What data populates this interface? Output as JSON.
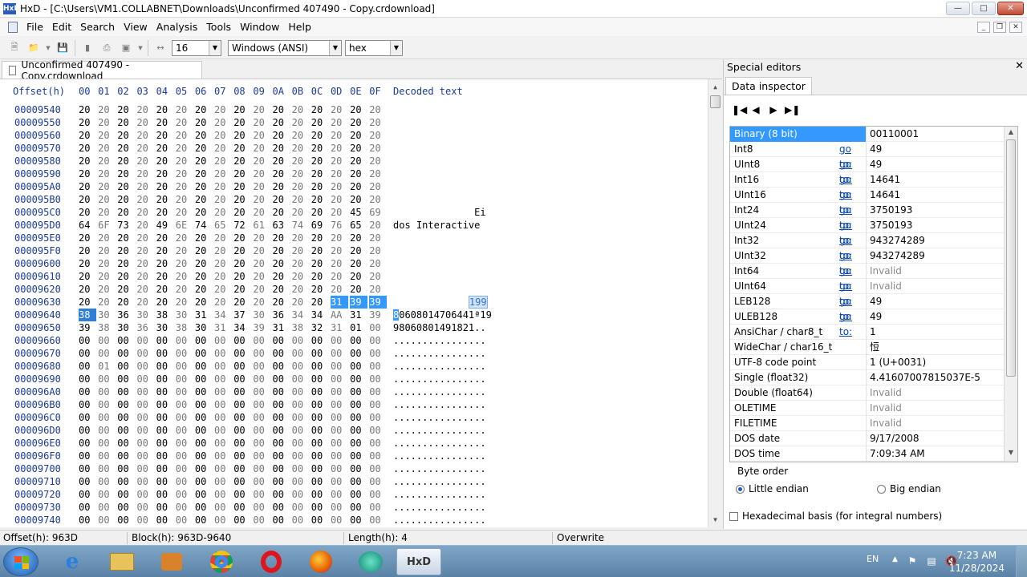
{
  "window": {
    "title": "HxD - [C:\\Users\\VM1.COLLABNET\\Downloads\\Unconfirmed 407490 - Copy.crdownload]",
    "app_icon_text": "HxD"
  },
  "menu": [
    "File",
    "Edit",
    "Search",
    "View",
    "Analysis",
    "Tools",
    "Window",
    "Help"
  ],
  "toolbar": {
    "bytes_per_row": "16",
    "charset": "Windows (ANSI)",
    "base": "hex"
  },
  "document_tab": "Unconfirmed 407490 - Copy.crdownload",
  "hex_view": {
    "offset_header": "Offset(h)",
    "columns": [
      "00",
      "01",
      "02",
      "03",
      "04",
      "05",
      "06",
      "07",
      "08",
      "09",
      "0A",
      "0B",
      "0C",
      "0D",
      "0E",
      "0F"
    ],
    "decoded_header": "Decoded text",
    "rows": [
      {
        "offset": "00009540",
        "bytes": [
          "20",
          "20",
          "20",
          "20",
          "20",
          "20",
          "20",
          "20",
          "20",
          "20",
          "20",
          "20",
          "20",
          "20",
          "20",
          "20"
        ],
        "text": ""
      },
      {
        "offset": "00009550",
        "bytes": [
          "20",
          "20",
          "20",
          "20",
          "20",
          "20",
          "20",
          "20",
          "20",
          "20",
          "20",
          "20",
          "20",
          "20",
          "20",
          "20"
        ],
        "text": ""
      },
      {
        "offset": "00009560",
        "bytes": [
          "20",
          "20",
          "20",
          "20",
          "20",
          "20",
          "20",
          "20",
          "20",
          "20",
          "20",
          "20",
          "20",
          "20",
          "20",
          "20"
        ],
        "text": ""
      },
      {
        "offset": "00009570",
        "bytes": [
          "20",
          "20",
          "20",
          "20",
          "20",
          "20",
          "20",
          "20",
          "20",
          "20",
          "20",
          "20",
          "20",
          "20",
          "20",
          "20"
        ],
        "text": ""
      },
      {
        "offset": "00009580",
        "bytes": [
          "20",
          "20",
          "20",
          "20",
          "20",
          "20",
          "20",
          "20",
          "20",
          "20",
          "20",
          "20",
          "20",
          "20",
          "20",
          "20"
        ],
        "text": ""
      },
      {
        "offset": "00009590",
        "bytes": [
          "20",
          "20",
          "20",
          "20",
          "20",
          "20",
          "20",
          "20",
          "20",
          "20",
          "20",
          "20",
          "20",
          "20",
          "20",
          "20"
        ],
        "text": ""
      },
      {
        "offset": "000095A0",
        "bytes": [
          "20",
          "20",
          "20",
          "20",
          "20",
          "20",
          "20",
          "20",
          "20",
          "20",
          "20",
          "20",
          "20",
          "20",
          "20",
          "20"
        ],
        "text": ""
      },
      {
        "offset": "000095B0",
        "bytes": [
          "20",
          "20",
          "20",
          "20",
          "20",
          "20",
          "20",
          "20",
          "20",
          "20",
          "20",
          "20",
          "20",
          "20",
          "20",
          "20"
        ],
        "text": ""
      },
      {
        "offset": "000095C0",
        "bytes": [
          "20",
          "20",
          "20",
          "20",
          "20",
          "20",
          "20",
          "20",
          "20",
          "20",
          "20",
          "20",
          "20",
          "20",
          "45",
          "69"
        ],
        "text": "              Ei"
      },
      {
        "offset": "000095D0",
        "bytes": [
          "64",
          "6F",
          "73",
          "20",
          "49",
          "6E",
          "74",
          "65",
          "72",
          "61",
          "63",
          "74",
          "69",
          "76",
          "65",
          "20"
        ],
        "text": "dos Interactive "
      },
      {
        "offset": "000095E0",
        "bytes": [
          "20",
          "20",
          "20",
          "20",
          "20",
          "20",
          "20",
          "20",
          "20",
          "20",
          "20",
          "20",
          "20",
          "20",
          "20",
          "20"
        ],
        "text": ""
      },
      {
        "offset": "000095F0",
        "bytes": [
          "20",
          "20",
          "20",
          "20",
          "20",
          "20",
          "20",
          "20",
          "20",
          "20",
          "20",
          "20",
          "20",
          "20",
          "20",
          "20"
        ],
        "text": ""
      },
      {
        "offset": "00009600",
        "bytes": [
          "20",
          "20",
          "20",
          "20",
          "20",
          "20",
          "20",
          "20",
          "20",
          "20",
          "20",
          "20",
          "20",
          "20",
          "20",
          "20"
        ],
        "text": ""
      },
      {
        "offset": "00009610",
        "bytes": [
          "20",
          "20",
          "20",
          "20",
          "20",
          "20",
          "20",
          "20",
          "20",
          "20",
          "20",
          "20",
          "20",
          "20",
          "20",
          "20"
        ],
        "text": ""
      },
      {
        "offset": "00009620",
        "bytes": [
          "20",
          "20",
          "20",
          "20",
          "20",
          "20",
          "20",
          "20",
          "20",
          "20",
          "20",
          "20",
          "20",
          "20",
          "20",
          "20"
        ],
        "text": ""
      },
      {
        "offset": "00009630",
        "bytes": [
          "20",
          "20",
          "20",
          "20",
          "20",
          "20",
          "20",
          "20",
          "20",
          "20",
          "20",
          "20",
          "20",
          "31",
          "39",
          "39"
        ],
        "text": "             199"
      },
      {
        "offset": "00009640",
        "bytes": [
          "38",
          "30",
          "36",
          "30",
          "38",
          "30",
          "31",
          "34",
          "37",
          "30",
          "36",
          "34",
          "34",
          "AA",
          "31",
          "39"
        ],
        "text": "80608014706441ª19"
      },
      {
        "offset": "00009650",
        "bytes": [
          "39",
          "38",
          "30",
          "36",
          "30",
          "38",
          "30",
          "31",
          "34",
          "39",
          "31",
          "38",
          "32",
          "31",
          "01",
          "00"
        ],
        "text": "98060801491821.."
      },
      {
        "offset": "00009660",
        "bytes": [
          "00",
          "00",
          "00",
          "00",
          "00",
          "00",
          "00",
          "00",
          "00",
          "00",
          "00",
          "00",
          "00",
          "00",
          "00",
          "00"
        ],
        "text": "................"
      },
      {
        "offset": "00009670",
        "bytes": [
          "00",
          "00",
          "00",
          "00",
          "00",
          "00",
          "00",
          "00",
          "00",
          "00",
          "00",
          "00",
          "00",
          "00",
          "00",
          "00"
        ],
        "text": "................"
      },
      {
        "offset": "00009680",
        "bytes": [
          "00",
          "01",
          "00",
          "00",
          "00",
          "00",
          "00",
          "00",
          "00",
          "00",
          "00",
          "00",
          "00",
          "00",
          "00",
          "00"
        ],
        "text": "................"
      },
      {
        "offset": "00009690",
        "bytes": [
          "00",
          "00",
          "00",
          "00",
          "00",
          "00",
          "00",
          "00",
          "00",
          "00",
          "00",
          "00",
          "00",
          "00",
          "00",
          "00"
        ],
        "text": "................"
      },
      {
        "offset": "000096A0",
        "bytes": [
          "00",
          "00",
          "00",
          "00",
          "00",
          "00",
          "00",
          "00",
          "00",
          "00",
          "00",
          "00",
          "00",
          "00",
          "00",
          "00"
        ],
        "text": "................"
      },
      {
        "offset": "000096B0",
        "bytes": [
          "00",
          "00",
          "00",
          "00",
          "00",
          "00",
          "00",
          "00",
          "00",
          "00",
          "00",
          "00",
          "00",
          "00",
          "00",
          "00"
        ],
        "text": "................"
      },
      {
        "offset": "000096C0",
        "bytes": [
          "00",
          "00",
          "00",
          "00",
          "00",
          "00",
          "00",
          "00",
          "00",
          "00",
          "00",
          "00",
          "00",
          "00",
          "00",
          "00"
        ],
        "text": "................"
      },
      {
        "offset": "000096D0",
        "bytes": [
          "00",
          "00",
          "00",
          "00",
          "00",
          "00",
          "00",
          "00",
          "00",
          "00",
          "00",
          "00",
          "00",
          "00",
          "00",
          "00"
        ],
        "text": "................"
      },
      {
        "offset": "000096E0",
        "bytes": [
          "00",
          "00",
          "00",
          "00",
          "00",
          "00",
          "00",
          "00",
          "00",
          "00",
          "00",
          "00",
          "00",
          "00",
          "00",
          "00"
        ],
        "text": "................"
      },
      {
        "offset": "000096F0",
        "bytes": [
          "00",
          "00",
          "00",
          "00",
          "00",
          "00",
          "00",
          "00",
          "00",
          "00",
          "00",
          "00",
          "00",
          "00",
          "00",
          "00"
        ],
        "text": "................"
      },
      {
        "offset": "00009700",
        "bytes": [
          "00",
          "00",
          "00",
          "00",
          "00",
          "00",
          "00",
          "00",
          "00",
          "00",
          "00",
          "00",
          "00",
          "00",
          "00",
          "00"
        ],
        "text": "................"
      },
      {
        "offset": "00009710",
        "bytes": [
          "00",
          "00",
          "00",
          "00",
          "00",
          "00",
          "00",
          "00",
          "00",
          "00",
          "00",
          "00",
          "00",
          "00",
          "00",
          "00"
        ],
        "text": "................"
      },
      {
        "offset": "00009720",
        "bytes": [
          "00",
          "00",
          "00",
          "00",
          "00",
          "00",
          "00",
          "00",
          "00",
          "00",
          "00",
          "00",
          "00",
          "00",
          "00",
          "00"
        ],
        "text": "................"
      },
      {
        "offset": "00009730",
        "bytes": [
          "00",
          "00",
          "00",
          "00",
          "00",
          "00",
          "00",
          "00",
          "00",
          "00",
          "00",
          "00",
          "00",
          "00",
          "00",
          "00"
        ],
        "text": "................"
      },
      {
        "offset": "00009740",
        "bytes": [
          "00",
          "00",
          "00",
          "00",
          "00",
          "00",
          "00",
          "00",
          "00",
          "00",
          "00",
          "00",
          "00",
          "00",
          "00",
          "00"
        ],
        "text": "................"
      }
    ]
  },
  "special_editors": {
    "title": "Special editors",
    "tab": "Data inspector",
    "goto_label": "go to:",
    "rows": [
      {
        "name": "Binary (8 bit)",
        "value": "00110001",
        "goto": false,
        "invalid": false,
        "selected": true
      },
      {
        "name": "Int8",
        "value": "49",
        "goto": true,
        "invalid": false
      },
      {
        "name": "UInt8",
        "value": "49",
        "goto": true,
        "invalid": false
      },
      {
        "name": "Int16",
        "value": "14641",
        "goto": true,
        "invalid": false
      },
      {
        "name": "UInt16",
        "value": "14641",
        "goto": true,
        "invalid": false
      },
      {
        "name": "Int24",
        "value": "3750193",
        "goto": true,
        "invalid": false
      },
      {
        "name": "UInt24",
        "value": "3750193",
        "goto": true,
        "invalid": false
      },
      {
        "name": "Int32",
        "value": "943274289",
        "goto": true,
        "invalid": false
      },
      {
        "name": "UInt32",
        "value": "943274289",
        "goto": true,
        "invalid": false
      },
      {
        "name": "Int64",
        "value": "Invalid",
        "goto": true,
        "invalid": true
      },
      {
        "name": "UInt64",
        "value": "Invalid",
        "goto": true,
        "invalid": true
      },
      {
        "name": "LEB128",
        "value": "49",
        "goto": true,
        "invalid": false
      },
      {
        "name": "ULEB128",
        "value": "49",
        "goto": true,
        "invalid": false
      },
      {
        "name": "AnsiChar / char8_t",
        "value": "1",
        "goto": false,
        "invalid": false
      },
      {
        "name": "WideChar / char16_t",
        "value": "㤱",
        "goto": false,
        "invalid": false
      },
      {
        "name": "UTF-8 code point",
        "value": "1 (U+0031)",
        "goto": false,
        "invalid": false
      },
      {
        "name": "Single (float32)",
        "value": "4.41607007815037E-5",
        "goto": false,
        "invalid": false
      },
      {
        "name": "Double (float64)",
        "value": "Invalid",
        "goto": false,
        "invalid": true
      },
      {
        "name": "OLETIME",
        "value": "Invalid",
        "goto": false,
        "invalid": true
      },
      {
        "name": "FILETIME",
        "value": "Invalid",
        "goto": false,
        "invalid": true
      },
      {
        "name": "DOS date",
        "value": "9/17/2008",
        "goto": false,
        "invalid": false
      },
      {
        "name": "DOS time",
        "value": "7:09:34 AM",
        "goto": false,
        "invalid": false
      }
    ],
    "byte_order": {
      "label": "Byte order",
      "little": "Little endian",
      "big": "Big endian",
      "selected": "little"
    },
    "hex_basis_label": "Hexadecimal basis (for integral numbers)"
  },
  "status": {
    "offset": "Offset(h): 963D",
    "block": "Block(h): 963D-9640",
    "length": "Length(h): 4",
    "mode": "Overwrite"
  },
  "taskbar": {
    "lang": "EN",
    "time": "7:23 AM",
    "date": "11/28/2024",
    "apps": [
      "internet-explorer",
      "file-explorer",
      "media-player",
      "chrome",
      "opera",
      "firefox",
      "app-green",
      "hxd"
    ],
    "active_app_label": "HxD"
  },
  "colors": {
    "selection": "#3399ff",
    "offset_blue": "#1a3a99",
    "link_blue": "#0645ad"
  }
}
